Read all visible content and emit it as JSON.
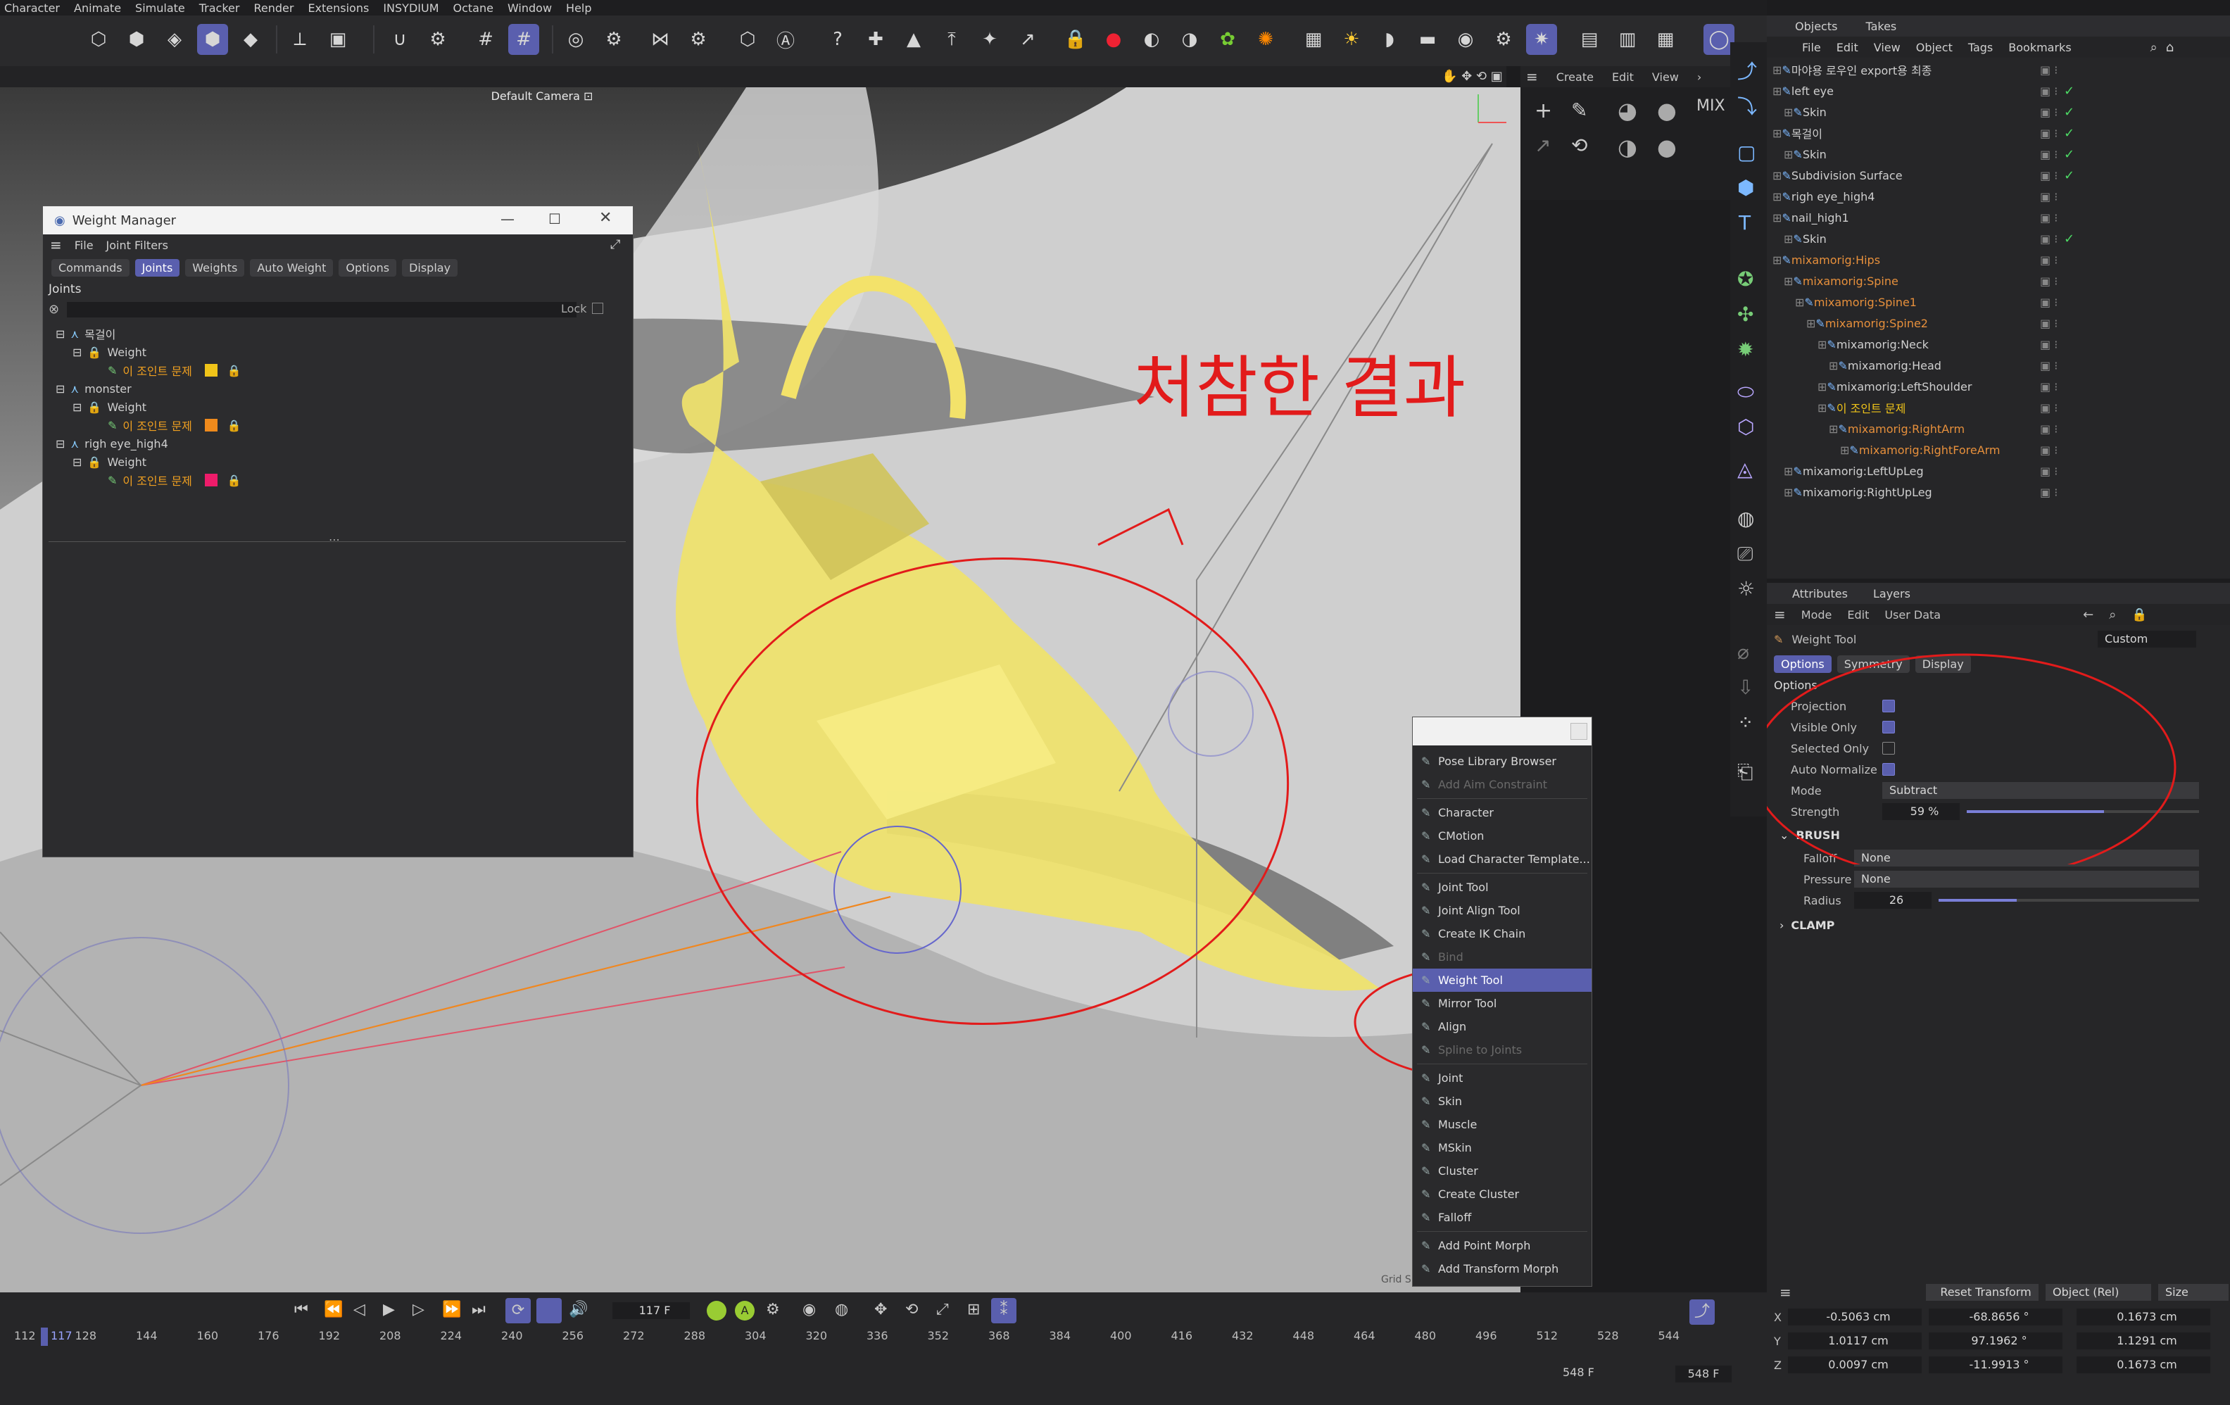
{
  "menubar": [
    "Character",
    "Animate",
    "Simulate",
    "Tracker",
    "Render",
    "Extensions",
    "INSYDIUM",
    "Octane",
    "Window",
    "Help"
  ],
  "viewport": {
    "camera_label": "Default Camera",
    "menu": [
      "Create",
      "Edit",
      "View"
    ],
    "annotation_text": "처참한 결과",
    "grid_label": "Grid Spacing"
  },
  "weight_manager": {
    "title": "Weight Manager",
    "menu": [
      "File",
      "Joint Filters"
    ],
    "tabs": [
      "Commands",
      "Joints",
      "Weights",
      "Auto Weight",
      "Options",
      "Display"
    ],
    "active_tab": "Joints",
    "section_label": "Joints",
    "lock_label": "Lock",
    "groups": [
      {
        "name": "목걸이",
        "weight": "Weight",
        "joint": "이 조인트 문제",
        "color": "#f0c419"
      },
      {
        "name": "monster",
        "weight": "Weight",
        "joint": "이 조인트 문제",
        "color": "#ef8a1c"
      },
      {
        "name": "righ eye_high4",
        "weight": "Weight",
        "joint": "이 조인트 문제",
        "color": "#ee1c6a"
      }
    ]
  },
  "popup_menu": {
    "items": [
      {
        "label": "Pose Library Browser",
        "state": "normal",
        "icon": "pose-icon"
      },
      {
        "label": "Add Aim Constraint",
        "state": "disabled",
        "icon": "aim-icon"
      },
      {
        "sep": true
      },
      {
        "label": "Character",
        "state": "normal",
        "icon": "character-icon"
      },
      {
        "label": "CMotion",
        "state": "normal",
        "icon": "cmotion-icon"
      },
      {
        "label": "Load Character Template...",
        "state": "normal",
        "icon": "template-icon"
      },
      {
        "sep": true
      },
      {
        "label": "Joint Tool",
        "state": "normal",
        "icon": "joint-tool-icon"
      },
      {
        "label": "Joint Align Tool",
        "state": "normal",
        "icon": "joint-align-icon"
      },
      {
        "label": "Create IK Chain",
        "state": "normal",
        "icon": "ik-icon"
      },
      {
        "label": "Bind",
        "state": "disabled",
        "icon": "bind-icon"
      },
      {
        "label": "Weight Tool",
        "state": "selected",
        "icon": "weight-tool-icon"
      },
      {
        "label": "Mirror Tool",
        "state": "normal",
        "icon": "mirror-icon"
      },
      {
        "label": "Align",
        "state": "normal",
        "icon": "align-icon"
      },
      {
        "label": "Spline to Joints",
        "state": "disabled",
        "icon": "spline-icon"
      },
      {
        "sep": true
      },
      {
        "label": "Joint",
        "state": "normal",
        "icon": "joint-icon"
      },
      {
        "label": "Skin",
        "state": "normal",
        "icon": "skin-icon"
      },
      {
        "label": "Muscle",
        "state": "normal",
        "icon": "muscle-icon"
      },
      {
        "label": "MSkin",
        "state": "normal",
        "icon": "mskin-icon"
      },
      {
        "label": "Cluster",
        "state": "normal",
        "icon": "cluster-icon"
      },
      {
        "label": "Create Cluster",
        "state": "normal",
        "icon": "create-cluster-icon"
      },
      {
        "label": "Falloff",
        "state": "normal",
        "icon": "falloff-icon"
      },
      {
        "sep": true
      },
      {
        "label": "Add Point Morph",
        "state": "normal",
        "icon": "point-morph-icon"
      },
      {
        "label": "Add Transform Morph",
        "state": "normal",
        "icon": "transform-morph-icon"
      }
    ]
  },
  "objects": {
    "tabs": [
      "Objects",
      "Takes"
    ],
    "menu": [
      "File",
      "Edit",
      "View",
      "Object",
      "Tags",
      "Bookmarks"
    ],
    "rows": [
      {
        "label": "마야용 로우인 export용 최종",
        "depth": 0,
        "color": "#cfcfcf",
        "ok": false
      },
      {
        "label": "left eye",
        "depth": 0,
        "color": "#cfcfcf",
        "ok": true
      },
      {
        "label": "Skin",
        "depth": 1,
        "color": "#cfcfcf",
        "ok": true
      },
      {
        "label": "목걸이",
        "depth": 0,
        "color": "#cfcfcf",
        "ok": true
      },
      {
        "label": "Skin",
        "depth": 1,
        "color": "#cfcfcf",
        "ok": true
      },
      {
        "label": "Subdivision Surface",
        "depth": 0,
        "color": "#cfcfcf",
        "ok": true
      },
      {
        "label": "righ eye_high4",
        "depth": 0,
        "color": "#cfcfcf",
        "ok": false
      },
      {
        "label": "nail_high1",
        "depth": 0,
        "color": "#cfcfcf",
        "ok": false
      },
      {
        "label": "Skin",
        "depth": 1,
        "color": "#cfcfcf",
        "ok": true
      },
      {
        "label": "mixamorig:Hips",
        "depth": 0,
        "color": "#e7903c",
        "ok": false
      },
      {
        "label": "mixamorig:Spine",
        "depth": 1,
        "color": "#e7903c",
        "ok": false
      },
      {
        "label": "mixamorig:Spine1",
        "depth": 2,
        "color": "#e7903c",
        "ok": false
      },
      {
        "label": "mixamorig:Spine2",
        "depth": 3,
        "color": "#e7903c",
        "ok": false
      },
      {
        "label": "mixamorig:Neck",
        "depth": 4,
        "color": "#cfcfcf",
        "ok": false
      },
      {
        "label": "mixamorig:Head",
        "depth": 5,
        "color": "#cfcfcf",
        "ok": false
      },
      {
        "label": "mixamorig:LeftShoulder",
        "depth": 4,
        "color": "#cfcfcf",
        "ok": false
      },
      {
        "label": "이 조인트 문제",
        "depth": 4,
        "color": "#f0c419",
        "ok": false
      },
      {
        "label": "mixamorig:RightArm",
        "depth": 5,
        "color": "#e7903c",
        "ok": false
      },
      {
        "label": "mixamorig:RightForeArm",
        "depth": 6,
        "color": "#e7903c",
        "ok": false
      },
      {
        "label": "mixamorig:LeftUpLeg",
        "depth": 1,
        "color": "#cfcfcf",
        "ok": false
      },
      {
        "label": "mixamorig:RightUpLeg",
        "depth": 1,
        "color": "#cfcfcf",
        "ok": false
      }
    ]
  },
  "attributes": {
    "tabs": [
      "Attributes",
      "Layers"
    ],
    "menu": [
      "Mode",
      "Edit",
      "User Data"
    ],
    "tool_name": "Weight Tool",
    "preset": "Custom",
    "subtabs": [
      "Options",
      "Symmetry",
      "Display"
    ],
    "section": "Options",
    "projection": "Projection",
    "visible_only": "Visible Only",
    "selected_only": "Selected Only",
    "auto_normalize": "Auto Normalize",
    "mode_label": "Mode",
    "mode_value": "Subtract",
    "strength_label": "Strength",
    "strength_value": "59 %",
    "strength_fraction": 0.59,
    "brush_label": "BRUSH",
    "falloff_label": "Falloff",
    "falloff_value": "None",
    "pressure_label": "Pressure",
    "pressure_value": "None",
    "radius_label": "Radius",
    "radius_value": "26",
    "clamp_label": "CLAMP"
  },
  "coords": {
    "reset": "Reset Transform",
    "mode": "Object (Rel)",
    "size": "Size",
    "rows": [
      {
        "axis": "X",
        "pos": "-0.5063 cm",
        "rot": "-68.8656 °",
        "size": "0.1673 cm"
      },
      {
        "axis": "Y",
        "pos": "1.0117 cm",
        "rot": "97.1962 °",
        "size": "1.1291 cm"
      },
      {
        "axis": "Z",
        "pos": "0.0097 cm",
        "rot": "-11.9913 °",
        "size": "0.1673 cm"
      }
    ]
  },
  "timeline": {
    "frame": "117 F",
    "marker": "117",
    "ticks": [
      "112",
      "128",
      "144",
      "160",
      "176",
      "192",
      "208",
      "224",
      "240",
      "256",
      "272",
      "288",
      "304",
      "320",
      "336",
      "352",
      "368",
      "384",
      "400",
      "416",
      "432",
      "448",
      "464",
      "480",
      "496",
      "512",
      "528",
      "544"
    ],
    "end_a": "548 F",
    "end_b": "548 F"
  }
}
